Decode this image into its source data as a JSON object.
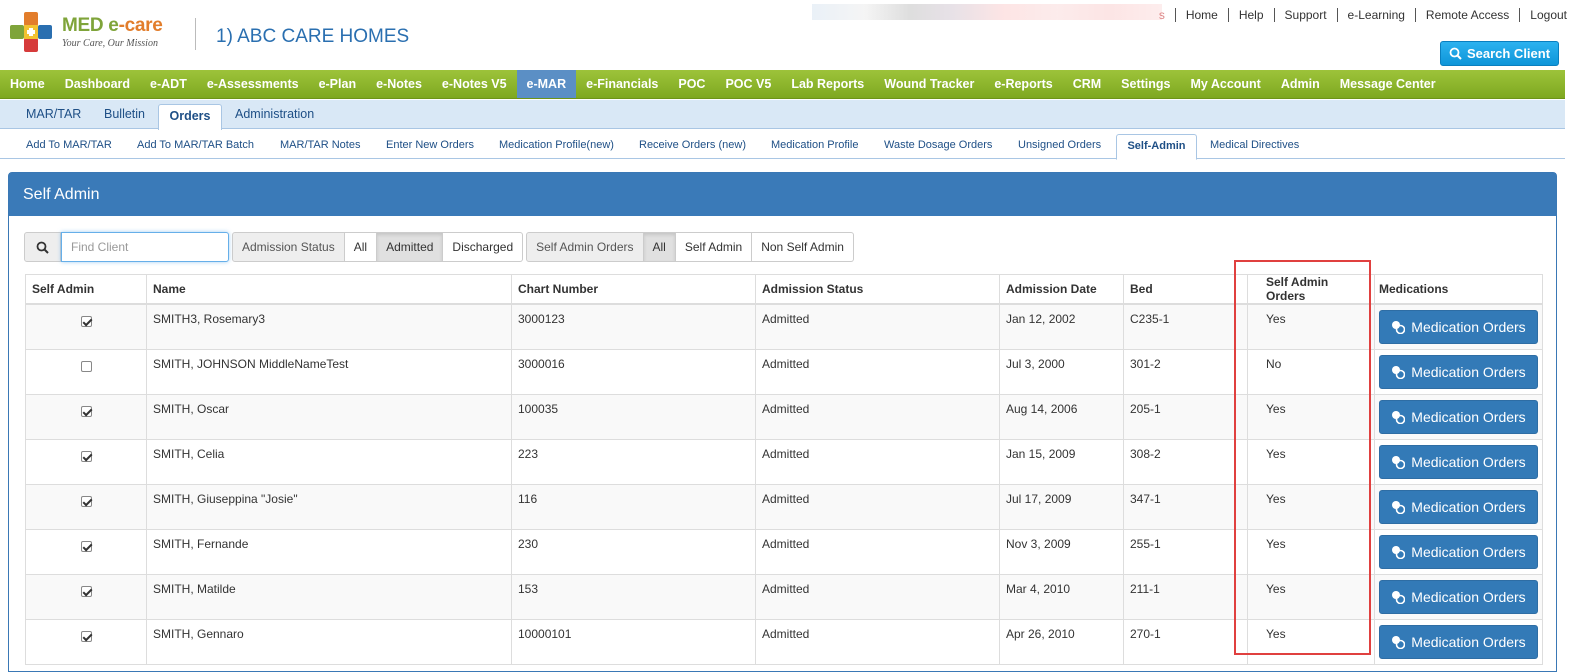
{
  "brand": {
    "name_part1": "MED e",
    "name_part2": "-care",
    "tagline": "Your Care, Our Mission",
    "facility": "1) ABC CARE HOMES"
  },
  "top_links": [
    "s",
    "Home",
    "Help",
    "Support",
    "e-Learning",
    "Remote Access",
    "Logout"
  ],
  "search_client_label": "Search Client",
  "main_nav": [
    "Home",
    "Dashboard",
    "e-ADT",
    "e-Assessments",
    "e-Plan",
    "e-Notes",
    "e-Notes V5",
    "e-MAR",
    "e-Financials",
    "POC",
    "POC V5",
    "Lab Reports",
    "Wound Tracker",
    "e-Reports",
    "CRM",
    "Settings",
    "My Account",
    "Admin",
    "Message Center"
  ],
  "main_nav_active": "e-MAR",
  "sub_nav": [
    "MAR/TAR",
    "Bulletin",
    "Orders",
    "Administration"
  ],
  "sub_nav_active": "Orders",
  "third_nav": [
    "Add To MAR/TAR",
    "Add To MAR/TAR Batch",
    "MAR/TAR Notes",
    "Enter New Orders",
    "Medication Profile(new)",
    "Receive Orders (new)",
    "Medication Profile",
    "Waste Dosage Orders",
    "Unsigned Orders",
    "Self-Admin",
    "Medical Directives"
  ],
  "third_nav_active": "Self-Admin",
  "panel_title": "Self Admin",
  "filters": {
    "find_placeholder": "Find Client",
    "admission_label": "Admission Status",
    "admission_options": [
      "All",
      "Admitted",
      "Discharged"
    ],
    "admission_selected": "Admitted",
    "self_admin_label": "Self Admin Orders",
    "self_admin_options": [
      "All",
      "Self Admin",
      "Non Self Admin"
    ],
    "self_admin_selected": "All"
  },
  "table": {
    "columns": [
      "Self Admin",
      "Name",
      "Chart Number",
      "Admission Status",
      "Admission Date",
      "Bed",
      "Self Admin Orders",
      "Medications"
    ],
    "med_button_label": "Medication Orders",
    "rows": [
      {
        "self_admin": true,
        "name": "SMITH3, Rosemary3",
        "chart": "3000123",
        "status": "Admitted",
        "date": "Jan 12, 2002",
        "bed": "C235-1",
        "orders": "Yes"
      },
      {
        "self_admin": false,
        "name": "SMITH, JOHNSON MiddleNameTest",
        "chart": "3000016",
        "status": "Admitted",
        "date": "Jul 3, 2000",
        "bed": "301-2",
        "orders": "No"
      },
      {
        "self_admin": true,
        "name": "SMITH, Oscar",
        "chart": "100035",
        "status": "Admitted",
        "date": "Aug 14, 2006",
        "bed": "205-1",
        "orders": "Yes"
      },
      {
        "self_admin": true,
        "name": "SMITH, Celia",
        "chart": "223",
        "status": "Admitted",
        "date": "Jan 15, 2009",
        "bed": "308-2",
        "orders": "Yes"
      },
      {
        "self_admin": true,
        "name": "SMITH, Giuseppina \"Josie\"",
        "chart": "116",
        "status": "Admitted",
        "date": "Jul 17, 2009",
        "bed": "347-1",
        "orders": "Yes"
      },
      {
        "self_admin": true,
        "name": "SMITH, Fernande",
        "chart": "230",
        "status": "Admitted",
        "date": "Nov 3, 2009",
        "bed": "255-1",
        "orders": "Yes"
      },
      {
        "self_admin": true,
        "name": "SMITH, Matilde",
        "chart": "153",
        "status": "Admitted",
        "date": "Mar 4, 2010",
        "bed": "211-1",
        "orders": "Yes"
      },
      {
        "self_admin": true,
        "name": "SMITH, Gennaro",
        "chart": "10000101",
        "status": "Admitted",
        "date": "Apr 26, 2010",
        "bed": "270-1",
        "orders": "Yes"
      }
    ]
  },
  "colors": {
    "nav_green": "#8bb42b",
    "active_tab": "#5b8fc5",
    "panel_blue": "#3a7ab8",
    "button_blue": "#337ab7",
    "highlight_red": "#e0403f"
  }
}
